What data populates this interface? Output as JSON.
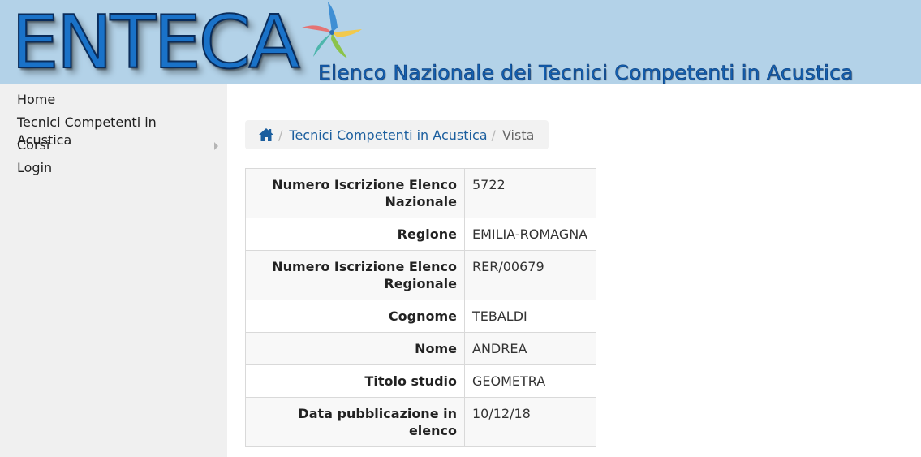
{
  "header": {
    "logo": "ENTECA",
    "subtitle": "Elenco Nazionale dei Tecnici Competenti in Acustica"
  },
  "sidebar": {
    "items": [
      {
        "label": "Home",
        "has_submenu": false
      },
      {
        "label": "Tecnici Competenti in Acustica",
        "has_submenu": false
      },
      {
        "label": "Corsi",
        "has_submenu": true
      },
      {
        "label": "Login",
        "has_submenu": false
      }
    ]
  },
  "breadcrumb": {
    "icon": "home-icon",
    "separator": "/",
    "link": "Tecnici Competenti in Acustica",
    "current": "Vista"
  },
  "details": {
    "rows": [
      {
        "label": "Numero Iscrizione Elenco Nazionale",
        "value": "5722"
      },
      {
        "label": "Regione",
        "value": "EMILIA-ROMAGNA"
      },
      {
        "label": "Numero Iscrizione Elenco Regionale",
        "value": "RER/00679"
      },
      {
        "label": "Cognome",
        "value": "TEBALDI"
      },
      {
        "label": "Nome",
        "value": "ANDREA"
      },
      {
        "label": "Titolo studio",
        "value": "GEOMETRA"
      },
      {
        "label": "Data pubblicazione in elenco",
        "value": "10/12/18"
      }
    ]
  },
  "colors": {
    "header_bg": "#b3d2e8",
    "logo_blue": "#1a72c8",
    "link_blue": "#1b5e9e",
    "sidebar_bg": "#f0f0f0"
  }
}
